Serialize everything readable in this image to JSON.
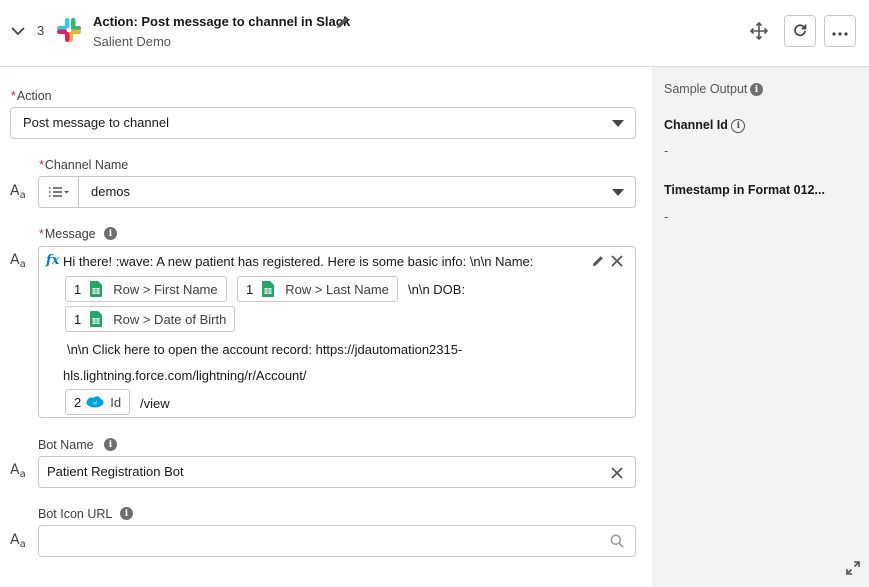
{
  "header": {
    "step_number": "3",
    "title": "Action: Post message to channel in Slack",
    "subtitle": "Salient Demo"
  },
  "form": {
    "action": {
      "label": "Action",
      "value": "Post message to channel"
    },
    "channel": {
      "label": "Channel Name",
      "value": "demos"
    },
    "message": {
      "label": "Message",
      "fx": "fx",
      "line1": "Hi there! :wave: A new patient has registered. Here is some basic info: \\n\\n Name:",
      "pill_first": {
        "num": "1",
        "text": "Row > First Name"
      },
      "pill_last": {
        "num": "1",
        "text": "Row > Last Name"
      },
      "dob_text": "\\n\\n DOB:",
      "pill_dob": {
        "num": "1",
        "text": "Row > Date of Birth"
      },
      "line_click": "\\n\\n Click here to open the account record: https://jdautomation2315-",
      "line_url": "hls.lightning.force.com/lightning/r/Account/",
      "pill_id": {
        "num": "2",
        "text": "Id"
      },
      "view_text": "/view"
    },
    "bot_name": {
      "label": "Bot Name",
      "value": "Patient Registration Bot"
    },
    "bot_icon": {
      "label": "Bot Icon URL",
      "value": ""
    }
  },
  "sample_output": {
    "title": "Sample Output",
    "fields": [
      {
        "label": "Channel Id",
        "value": "-"
      },
      {
        "label": "Timestamp in Format 012...",
        "value": "-"
      }
    ]
  },
  "icons": {
    "aa": "text-type-icon",
    "slack": "slack-logo",
    "sheets": "google-sheets-icon",
    "salesforce": "salesforce-icon"
  }
}
